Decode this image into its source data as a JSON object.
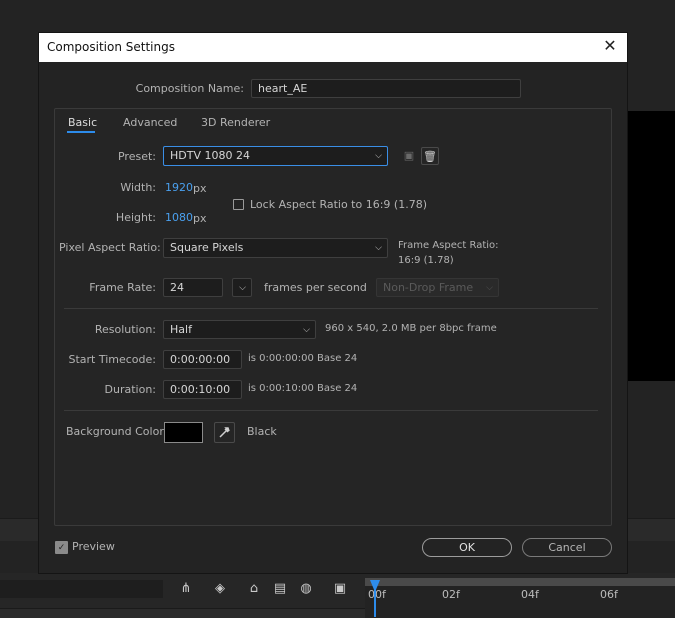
{
  "dialog": {
    "title": "Composition Settings",
    "comp_name_label": "Composition Name:",
    "comp_name_value": "heart_AE"
  },
  "tabs": [
    "Basic",
    "Advanced",
    "3D Renderer"
  ],
  "basic": {
    "preset_label": "Preset:",
    "preset_value": "HDTV 1080 24",
    "width_label": "Width:",
    "width_value": "1920",
    "width_unit": "px",
    "height_label": "Height:",
    "height_value": "1080",
    "height_unit": "px",
    "lock_label": "Lock Aspect Ratio to 16:9 (1.78)",
    "lock_checked": false,
    "par_label": "Pixel Aspect Ratio:",
    "par_value": "Square Pixels",
    "frame_aspect_label": "Frame Aspect Ratio:",
    "frame_aspect_value": "16:9 (1.78)",
    "frame_rate_label": "Frame Rate:",
    "frame_rate_value": "24",
    "fps_label": "frames per second",
    "drop_frame_value": "Non-Drop Frame",
    "resolution_label": "Resolution:",
    "resolution_value": "Half",
    "resolution_info": "960 x 540, 2.0 MB per 8bpc frame",
    "start_tc_label": "Start Timecode:",
    "start_tc_value": "0:00:00:00",
    "start_tc_info": "is 0:00:00:00  Base 24",
    "duration_label": "Duration:",
    "duration_value": "0:00:10:00",
    "duration_info": "is 0:00:10:00  Base 24",
    "bg_color_label": "Background Color:",
    "bg_color_hex": "#000000",
    "bg_color_name": "Black"
  },
  "footer": {
    "preview_label": "Preview",
    "preview_checked": true,
    "ok_label": "OK",
    "cancel_label": "Cancel"
  },
  "timeline": {
    "ruler_labels": [
      "00f",
      "02f",
      "04f",
      "06f"
    ]
  },
  "colors": {
    "accent": "#2d8ceb",
    "value_blue": "#4aa0ef",
    "dialog_bg": "#232323"
  }
}
